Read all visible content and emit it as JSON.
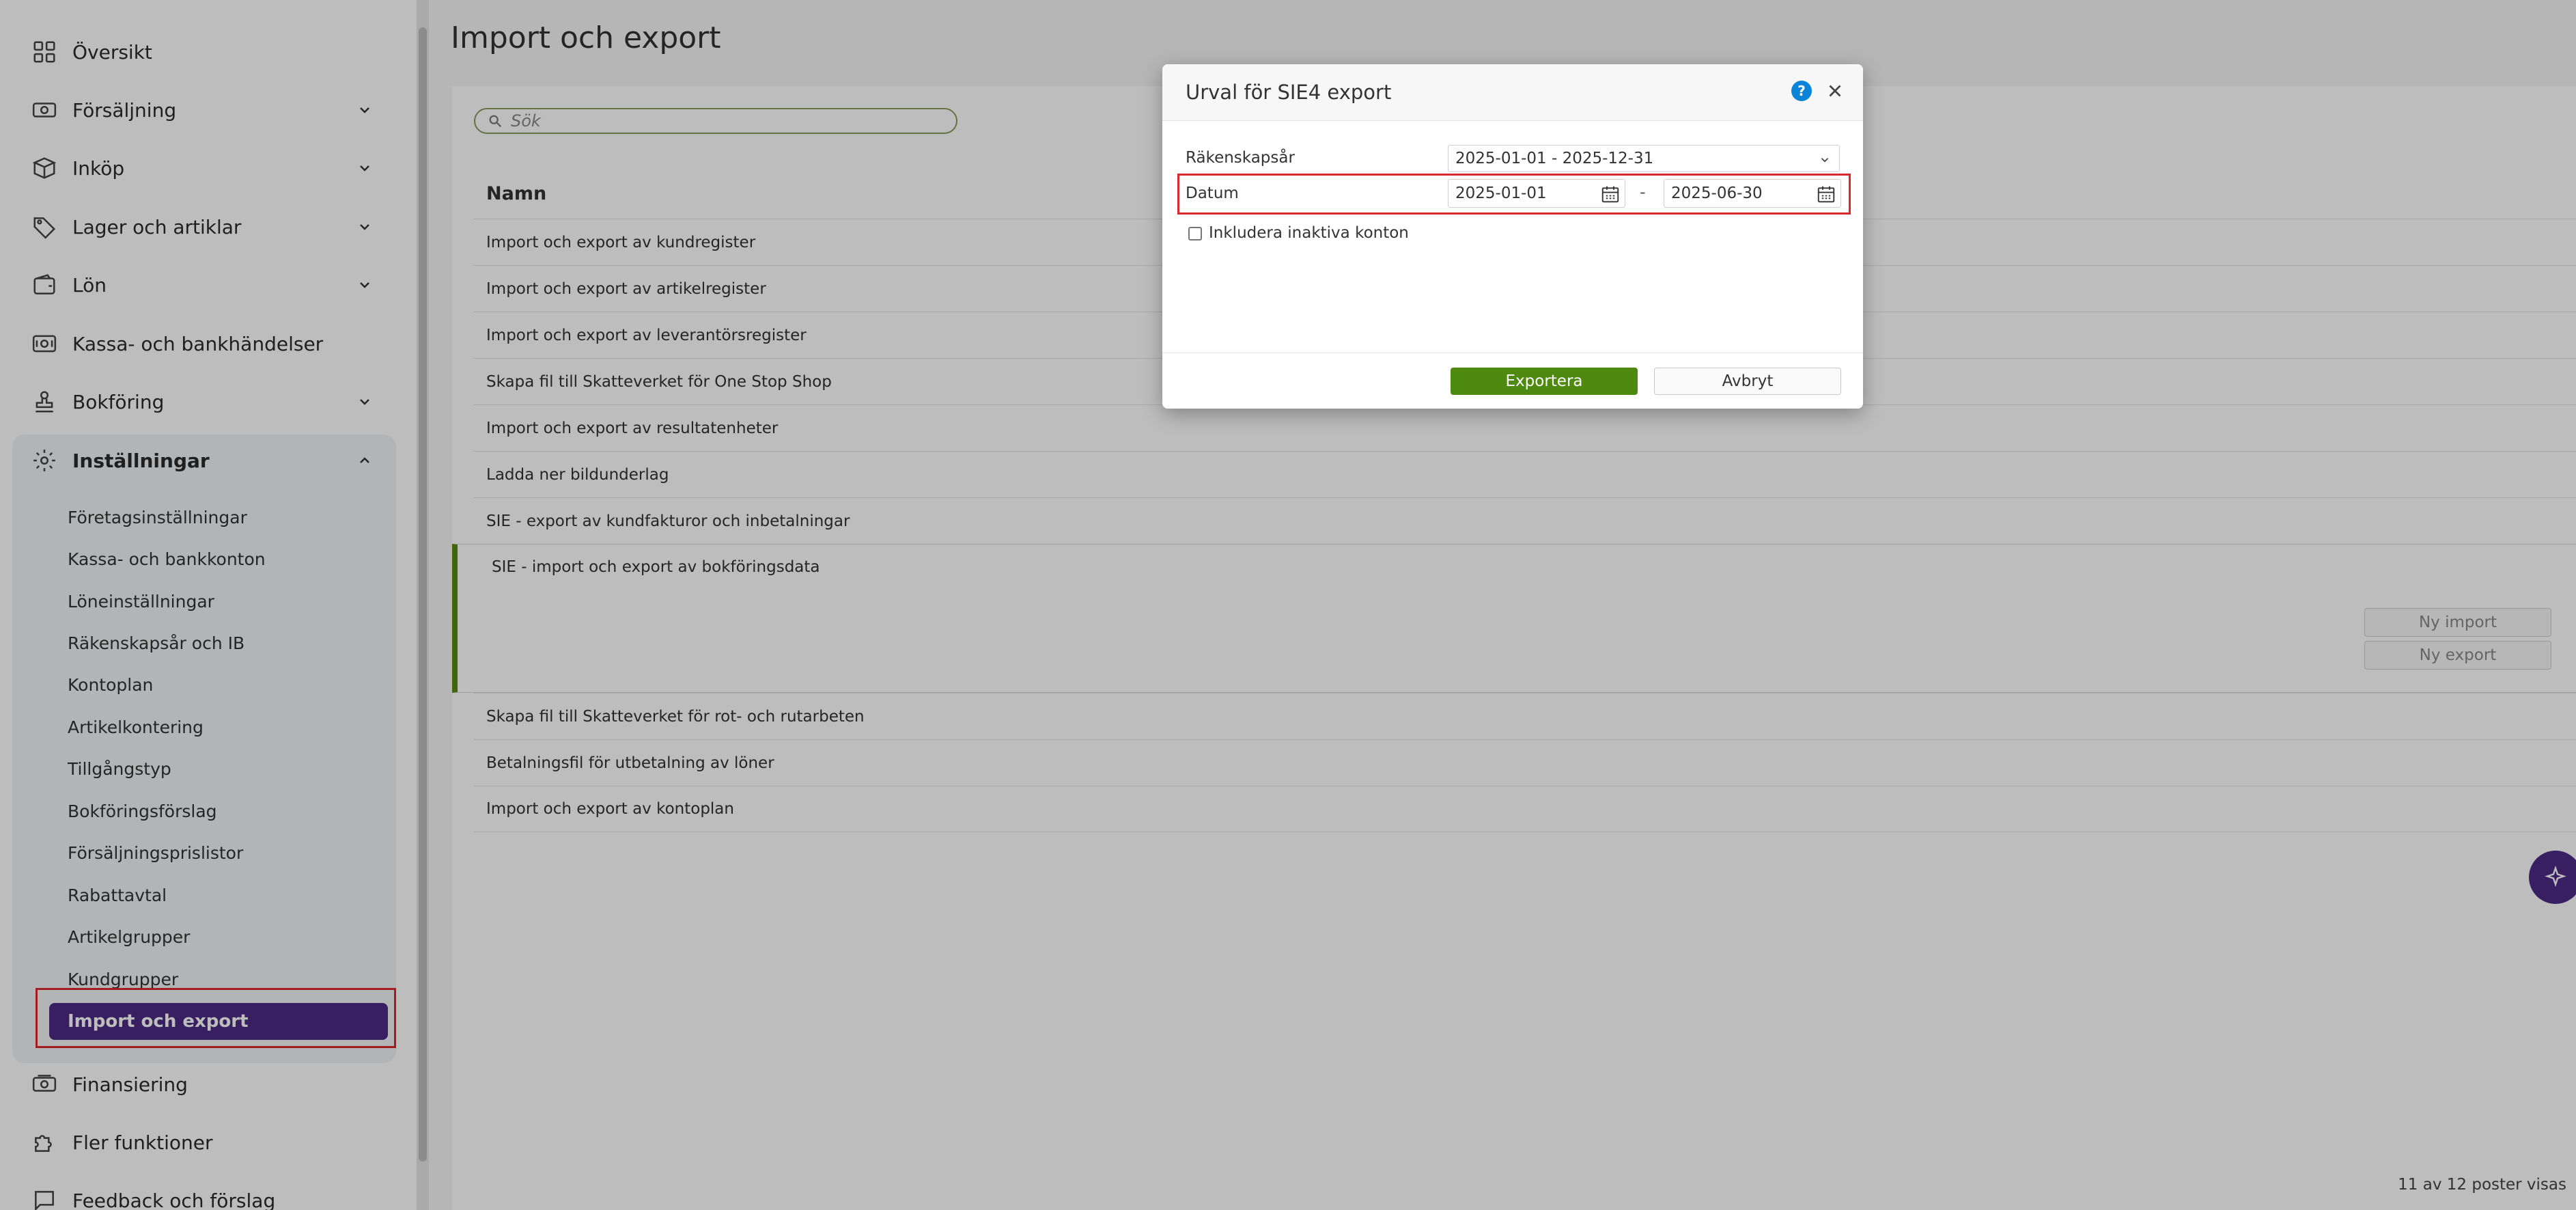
{
  "sidebar": {
    "items": [
      {
        "label": "Översikt",
        "icon": "grid-icon"
      },
      {
        "label": "Försäljning",
        "icon": "cash-icon"
      },
      {
        "label": "Inköp",
        "icon": "box-icon"
      },
      {
        "label": "Lager och artiklar",
        "icon": "tag-icon"
      },
      {
        "label": "Lön",
        "icon": "wallet-icon"
      },
      {
        "label": "Kassa- och bankhändelser",
        "icon": "bank-icon"
      },
      {
        "label": "Bokföring",
        "icon": "stamp-icon"
      },
      {
        "label": "Inställningar",
        "icon": "gear-icon"
      }
    ],
    "settings_sub": [
      "Företagsinställningar",
      "Kassa- och bankkonton",
      "Löneinställningar",
      "Räkenskapsår och IB",
      "Kontoplan",
      "Artikelkontering",
      "Tillgångstyp",
      "Bokföringsförslag",
      "Försäljningsprislistor",
      "Rabattavtal",
      "Artikelgrupper",
      "Kundgrupper"
    ],
    "active": "Import och export",
    "bottom_items": [
      {
        "label": "Finansiering",
        "icon": "money-icon"
      },
      {
        "label": "Fler funktioner",
        "icon": "puzzle-icon"
      },
      {
        "label": "Feedback och förslag",
        "icon": "chat-icon"
      }
    ]
  },
  "main": {
    "title": "Import och export",
    "search_placeholder": "Sök",
    "column_header": "Namn",
    "rows": [
      "Import och export av kundregister",
      "Import och export av artikelregister",
      "Import och export av leverantörsregister",
      "Skapa fil till Skatteverket för One Stop Shop",
      "Import och export av resultatenheter",
      "Ladda ner bildunderlag",
      "SIE - export av kundfakturor och inbetalningar",
      "SIE - import och export av bokföringsdata",
      "Skapa fil till Skatteverket för rot- och rutarbeten",
      "Betalningsfil för utbetalning av löner",
      "Import och export av kontoplan"
    ],
    "expanded_buttons": {
      "import": "Ny import",
      "export": "Ny export"
    },
    "footer": "11 av 12 poster visas"
  },
  "dialog": {
    "title": "Urval för SIE4 export",
    "help": "?",
    "fiscal_year_label": "Räkenskapsår",
    "fiscal_year_value": "2025-01-01 - 2025-12-31",
    "date_label": "Datum",
    "date_from": "2025-01-01",
    "date_separator": "-",
    "date_to": "2025-06-30",
    "checkbox_label": "Inkludera inaktiva konton",
    "export_button": "Exportera",
    "cancel_button": "Avbryt"
  },
  "colors": {
    "accent": "#4b2a85",
    "primary_button": "#4f8a10",
    "highlight": "#d9282f",
    "help": "#0a84d8"
  }
}
